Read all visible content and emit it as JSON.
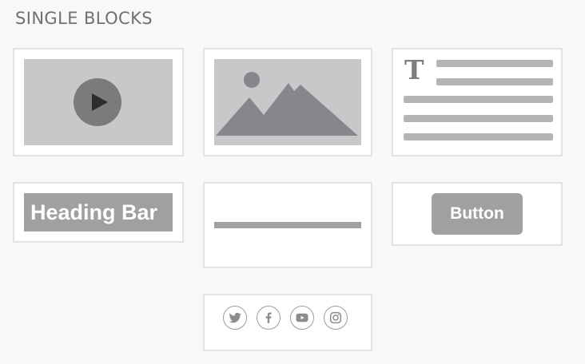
{
  "section": {
    "title": "SINGLE BLOCKS"
  },
  "blocks": {
    "video": {
      "icon": "play-icon"
    },
    "image": {
      "icon": "mountain-image-icon"
    },
    "text": {
      "glyph": "T",
      "icon": "text-lines-icon"
    },
    "heading_bar": {
      "label": "Heading Bar"
    },
    "divider": {
      "icon": "horizontal-rule-icon"
    },
    "button": {
      "label": "Button"
    },
    "social": {
      "icons": [
        "twitter-icon",
        "facebook-icon",
        "youtube-icon",
        "instagram-icon"
      ]
    }
  },
  "colors": {
    "background": "#f8f8f7",
    "block_border": "#e3e3e3",
    "placeholder_light": "#c8c7c9",
    "placeholder_mid": "#a09fa2",
    "placeholder_dark": "#7b7b7d",
    "title_text": "#707070"
  }
}
